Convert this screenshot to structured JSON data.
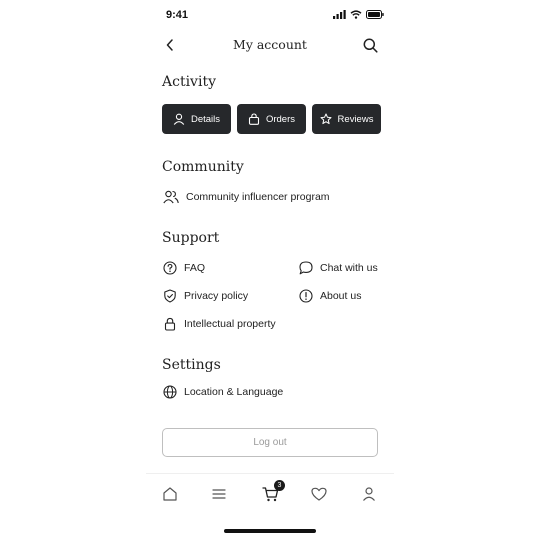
{
  "status_bar": {
    "time": "9:41"
  },
  "header": {
    "title": "My account"
  },
  "activity": {
    "title": "Activity",
    "buttons": [
      {
        "label": "Details",
        "icon": "user-icon"
      },
      {
        "label": "Orders",
        "icon": "bag-icon"
      },
      {
        "label": "Reviews",
        "icon": "star-icon"
      }
    ]
  },
  "community": {
    "title": "Community",
    "items": [
      {
        "label": "Community influencer program",
        "icon": "users-icon"
      }
    ]
  },
  "support": {
    "title": "Support",
    "items": [
      {
        "label": "FAQ",
        "icon": "help-circle-icon"
      },
      {
        "label": "Chat with us",
        "icon": "chat-bubble-icon"
      },
      {
        "label": "Privacy policy",
        "icon": "shield-check-icon"
      },
      {
        "label": "About us",
        "icon": "alert-circle-icon"
      },
      {
        "label": "Intellectual property",
        "icon": "lock-icon"
      }
    ]
  },
  "settings": {
    "title": "Settings",
    "items": [
      {
        "label": "Location & Language",
        "icon": "globe-icon"
      }
    ]
  },
  "logout": {
    "label": "Log out"
  },
  "tabbar": {
    "cart_count": "3",
    "tabs": [
      "home-icon",
      "menu-icon",
      "cart-icon",
      "heart-icon",
      "profile-icon"
    ]
  },
  "colors": {
    "button_bg": "#26282b",
    "text": "#222222",
    "muted": "#9a9a9a",
    "border": "#bfbfbf"
  }
}
